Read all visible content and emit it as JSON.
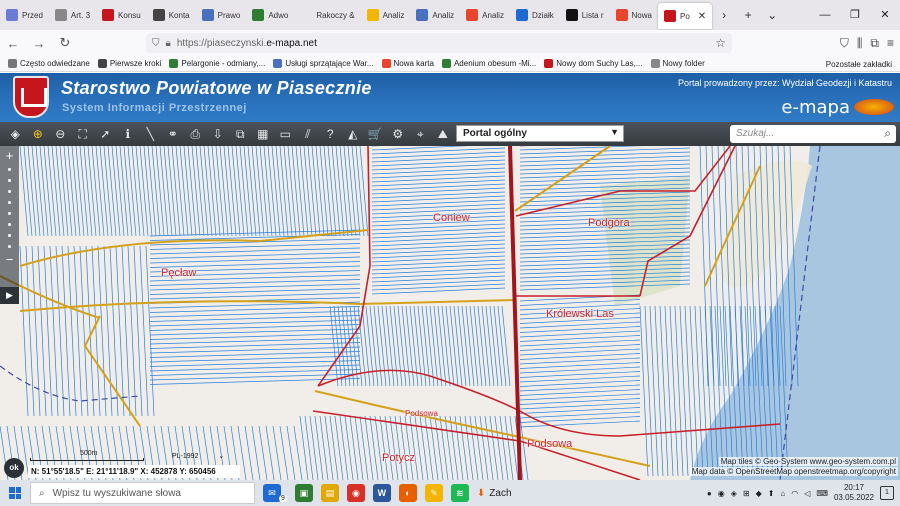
{
  "browser": {
    "tabs": [
      {
        "label": "Przed",
        "color": "#6b7bd8"
      },
      {
        "label": "Art. 3",
        "color": "#888888"
      },
      {
        "label": "Konsu",
        "color": "#c4161c"
      },
      {
        "label": "Konta",
        "color": "#444444"
      },
      {
        "label": "Prawo",
        "color": "#4a70c0"
      },
      {
        "label": "Adwo",
        "color": "#2e7d32"
      },
      {
        "label": "Rakoczy &",
        "color": "#e8e6ea"
      },
      {
        "label": "Analiz",
        "color": "#f4b400"
      },
      {
        "label": "Analiz",
        "color": "#4a70c0"
      },
      {
        "label": "Analiz",
        "color": "#e8452c"
      },
      {
        "label": "Działk",
        "color": "#1e6ad2"
      },
      {
        "label": "Lista r",
        "color": "#111111"
      },
      {
        "label": "Nowa",
        "color": "#e8452c"
      }
    ],
    "active_tab": {
      "label": "Po",
      "close": "✕"
    },
    "tab_scroll": "›",
    "new_tab": "+",
    "tab_list": "⌄",
    "window_controls": {
      "minimize": "—",
      "maximize": "❐",
      "close": "✕"
    },
    "nav": {
      "back": "←",
      "forward": "→",
      "reload": "↻"
    },
    "url": {
      "prefix": "https://piaseczynski.",
      "host": "e-mapa.net"
    },
    "bookmark_star": "☆",
    "toolbar_icons": [
      "⛉",
      "⫼",
      "⧉",
      "≡"
    ]
  },
  "bookmarks": {
    "items": [
      {
        "label": "Często odwiedzane",
        "color": "#777777"
      },
      {
        "label": "Pierwsze kroki",
        "color": "#444444"
      },
      {
        "label": "Pelargonie - odmiany,...",
        "color": "#2e7d32"
      },
      {
        "label": "Usługi sprzątające War...",
        "color": "#4a70c0"
      },
      {
        "label": "Nowa karta",
        "color": "#e8452c"
      },
      {
        "label": "Adenium obesum -Mi...",
        "color": "#2e7d32"
      },
      {
        "label": "Nowy dom Suchy Las,...",
        "color": "#c4161c"
      },
      {
        "label": "Nowy folder",
        "color": "#888888"
      }
    ],
    "other": "Pozostałe zakładki"
  },
  "portal": {
    "title": "Starostwo Powiatowe w Piasecznie",
    "subtitle": "System Informacji Przestrzennej",
    "run_by": "Portal prowadzony przez: Wydział Geodezji i Katastru",
    "brand": "e-mapa"
  },
  "toolbar": {
    "tools": [
      {
        "name": "layers-icon",
        "glyph": "◈"
      },
      {
        "name": "zoom-in-icon",
        "glyph": "⊕"
      },
      {
        "name": "zoom-out-icon",
        "glyph": "⊖"
      },
      {
        "name": "zoom-extent-icon",
        "glyph": "⛶"
      },
      {
        "name": "pointer-icon",
        "glyph": "➚"
      },
      {
        "name": "info-icon",
        "glyph": "ℹ"
      },
      {
        "name": "measure-icon",
        "glyph": "╲"
      },
      {
        "name": "link-icon",
        "glyph": "⚭"
      },
      {
        "name": "print-icon",
        "glyph": "⎙"
      },
      {
        "name": "download-icon",
        "glyph": "⇩"
      },
      {
        "name": "export-icon",
        "glyph": "⧉"
      },
      {
        "name": "table-icon",
        "glyph": "▦"
      },
      {
        "name": "comment-icon",
        "glyph": "▭"
      },
      {
        "name": "hatch-icon",
        "glyph": "⫽"
      },
      {
        "name": "help-icon",
        "glyph": "?"
      },
      {
        "name": "triangle-icon",
        "glyph": "◭"
      },
      {
        "name": "cart-icon",
        "glyph": "🛒"
      },
      {
        "name": "settings-icon",
        "glyph": "⚙"
      },
      {
        "name": "location-icon",
        "glyph": "⌖"
      },
      {
        "name": "terrain-icon",
        "glyph": "⛰"
      }
    ],
    "portal_select": "Portal ogólny",
    "search_placeholder": "Szukaj..."
  },
  "map": {
    "places": [
      {
        "label": "Coniew",
        "name": "place-coniew"
      },
      {
        "label": "Podgóra",
        "name": "place-podgora"
      },
      {
        "label": "Pęcław",
        "name": "place-peclaw"
      },
      {
        "label": "Królewski Las",
        "name": "place-krolewski-las"
      },
      {
        "label": "Podsowa",
        "name": "place-podsowa-small"
      },
      {
        "label": "Podsowa",
        "name": "place-podsowa"
      },
      {
        "label": "Potycz",
        "name": "place-potycz"
      }
    ],
    "zoom_in": "+",
    "zoom_out": "−",
    "pan": "▶",
    "attribution_1": "Map tiles © Geo-System www.geo-system.com.pl",
    "attribution_2": "Map data © OpenStreetMap openstreetmap.org/copyright",
    "scale": "500m",
    "crs": "PL-1992",
    "crs_arrow": "⌄",
    "coordinates": "N: 51°55'18.5\"  E: 21°11'18.9\"   X: 452878    Y: 650456",
    "ok": "ok",
    "colors": {
      "background": "#f1eeea",
      "parcel": "#2a7fd8",
      "boundary": "#c8202a",
      "road": "#d4a11a",
      "river": "#a9c6e0"
    }
  },
  "taskbar": {
    "search_placeholder": "Wpisz tu wyszukiwane słowa",
    "mail_badge": "9",
    "apps": [
      {
        "name": "mail-app-icon",
        "color": "#1e6ad2",
        "glyph": "✉"
      },
      {
        "name": "photos-app-icon",
        "color": "#2e7d32",
        "glyph": "▣"
      },
      {
        "name": "explorer-app-icon",
        "color": "#e0a800",
        "glyph": "▤"
      },
      {
        "name": "chrome-app-icon",
        "color": "#d93025",
        "glyph": "◉"
      },
      {
        "name": "word-app-icon",
        "color": "#2b579a",
        "glyph": "W"
      },
      {
        "name": "firefox-app-icon",
        "color": "#e66000",
        "glyph": "◐"
      },
      {
        "name": "paint-app-icon",
        "color": "#f4b400",
        "glyph": "✎"
      },
      {
        "name": "spotify-app-icon",
        "color": "#1db954",
        "glyph": "≋"
      }
    ],
    "active_app_label": "Zach",
    "tray_icons": [
      "●",
      "◉",
      "◈",
      "⊞",
      "◆",
      "⬆",
      "⌂",
      "◠",
      "◁",
      "⌨"
    ],
    "time": "20:17",
    "date": "03.05.2022",
    "notifications": "1"
  }
}
